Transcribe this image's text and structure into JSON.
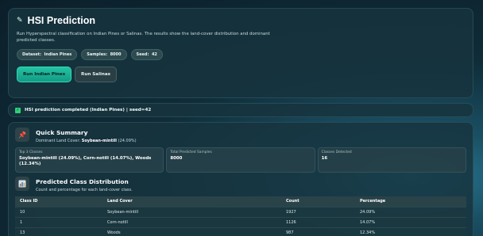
{
  "header": {
    "title": "HSI Prediction",
    "description": "Run Hyperspectral classification on Indian Pines or Salinas. The results show the land-cover distribution and dominant predicted classes.",
    "chips": [
      {
        "label": "Dataset:",
        "value": "Indian Pines"
      },
      {
        "label": "Samples:",
        "value": "8000"
      },
      {
        "label": "Seed:",
        "value": "42"
      }
    ],
    "buttons": {
      "run_indian_pines": "Run Indian Pines",
      "run_salinas": "Run Salinas"
    }
  },
  "status": {
    "text": "HSI prediction completed (Indian Pines) | seed=42"
  },
  "summary": {
    "title": "Quick Summary",
    "dominant_label": "Dominant Land Cover:",
    "dominant_value": "Soybean-mintill",
    "dominant_pct": "(24.09%)",
    "stats": [
      {
        "label": "Top 3 Classes",
        "value": "Soybean-mintill (24.09%), Corn-notill (14.07%), Woods (12.34%)"
      },
      {
        "label": "Total Predicted Samples",
        "value": "8000"
      },
      {
        "label": "Classes Detected",
        "value": "16"
      }
    ]
  },
  "distribution": {
    "title": "Predicted Class Distribution",
    "subtitle": "Count and percentage for each land-cover class.",
    "columns": [
      "Class ID",
      "Land Cover",
      "Count",
      "Percentage"
    ],
    "rows": [
      [
        "10",
        "Soybean-mintill",
        "1927",
        "24.09%"
      ],
      [
        "1",
        "Corn-notill",
        "1126",
        "14.07%"
      ],
      [
        "13",
        "Woods",
        "987",
        "12.34%"
      ]
    ]
  }
}
